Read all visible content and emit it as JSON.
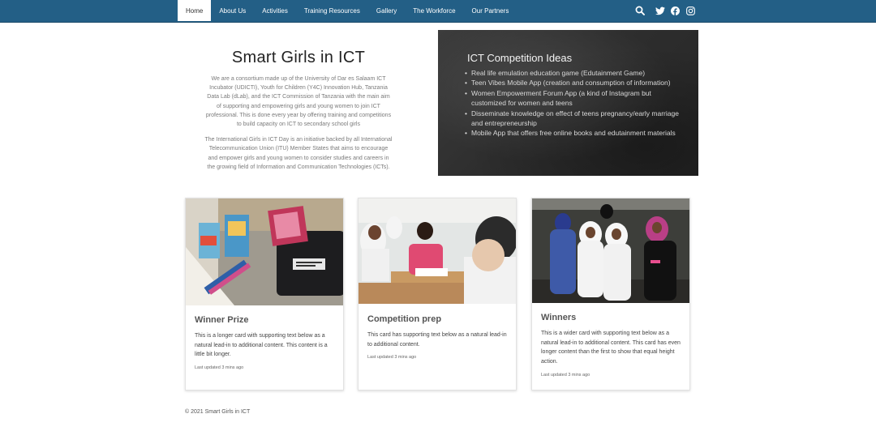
{
  "nav": {
    "items": [
      {
        "label": "Home",
        "active": true
      },
      {
        "label": "About Us"
      },
      {
        "label": "Activities"
      },
      {
        "label": "Training Resources"
      },
      {
        "label": "Gallery"
      },
      {
        "label": "The Workforce"
      },
      {
        "label": "Our Partners"
      }
    ],
    "icons": [
      "search-icon",
      "twitter-icon",
      "facebook-icon",
      "instagram-icon"
    ],
    "color": "#235f86"
  },
  "intro": {
    "title": "Smart Girls in ICT",
    "paragraph1": "We are a consortium made up of the University of Dar es Salaam ICT Incubator (UDICTI), Youth for Children (Y4C) Innovation Hub, Tanzania Data Lab (dLab), and the ICT Commission of Tanzania with the main aim of supporting and empowering girls and young women to join ICT professional. This is done every year by offering training and competitions to build capacity on ICT to secondary school girls",
    "paragraph2": "The International Girls in ICT Day is an initiative backed by all International Telecommunication Union (ITU) Member States that aims to encourage and empower girls and young women to consider studies and careers in the growing field of Information and Communication Technologies (ICTs)."
  },
  "board": {
    "title": "ICT Competition Ideas",
    "items": [
      "Real life emulation education game (Edutainment Game)",
      "Teen Vibes Mobile App (creation and consumption of information)",
      "Women Empowerment Forum App (a kind of Instagram but customized for women and teens",
      "Disseminate knowledge on effect of teens pregnancy/early marriage and entrepreneurship",
      "Mobile App that offers free online books and edutainment materials"
    ]
  },
  "cards": [
    {
      "title": "Winner Prize",
      "text": "This is a longer card with supporting text below as a natural lead-in to additional content. This content is a little bit longer.",
      "meta": "Last updated 3 mins ago"
    },
    {
      "title": "Competition prep",
      "text": "This card has supporting text below as a natural lead-in to additional content.",
      "meta": "Last updated 3 mins ago"
    },
    {
      "title": "Winners",
      "text": "This is a wider card with supporting text below as a natural lead-in to additional content. This card has even longer content than the first to show that equal height action.",
      "meta": "Last updated 3 mins ago"
    }
  ],
  "footer": {
    "text": "© 2021 Smart Girls in ICT"
  }
}
